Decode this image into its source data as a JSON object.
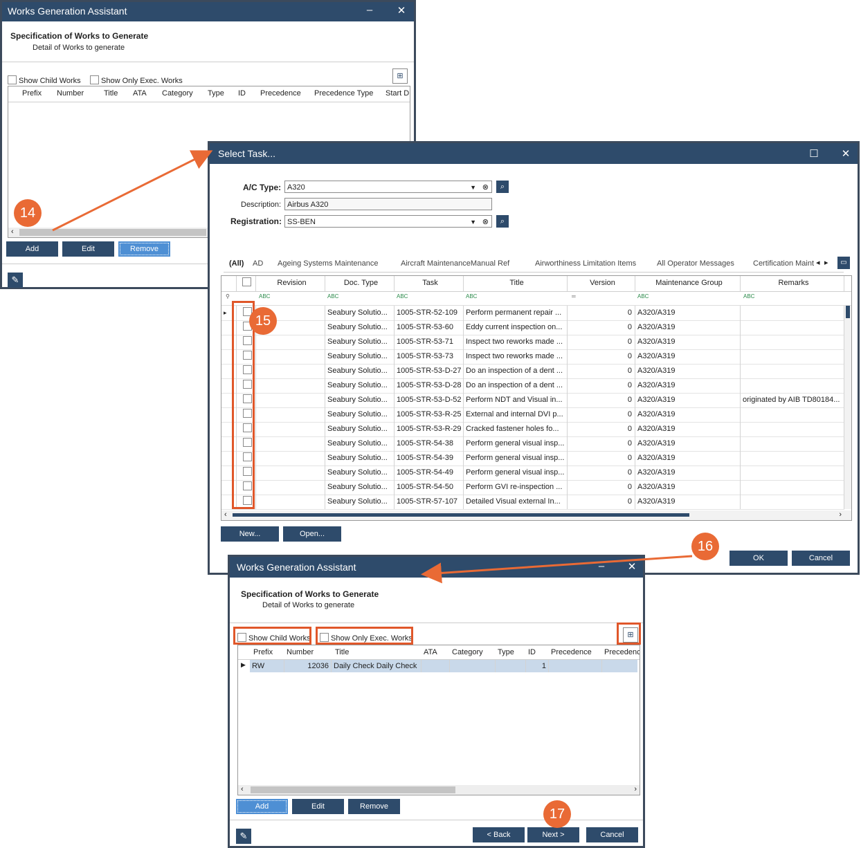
{
  "bg_window": {
    "title": "Works Generation Assistant",
    "heading": "Specification of Works to Generate",
    "subheading": "Detail of Works to generate",
    "show_child_works": "Show Child Works",
    "show_only_exec": "Show Only Exec. Works",
    "columns": [
      "Prefix",
      "Number",
      "Title",
      "ATA",
      "Category",
      "Type",
      "ID",
      "Precedence",
      "Precedence Type",
      "Start D"
    ],
    "add": "Add",
    "edit": "Edit",
    "remove": "Remove"
  },
  "select_task": {
    "title": "Select Task...",
    "ac_type_label": "A/C Type:",
    "ac_type_value": "A320",
    "description_label": "Description:",
    "description_value": "Airbus A320",
    "registration_label": "Registration:",
    "registration_value": "SS-BEN",
    "tabs": [
      "(All)",
      "AD",
      "Ageing Systems Maintenance",
      "Aircraft MaintenanceManual Ref",
      "Airworthiness Limitation Items",
      "All Operator Messages",
      "Certification Maint"
    ],
    "columns": [
      "Revision",
      "Doc. Type",
      "Task",
      "Title",
      "Version",
      "Maintenance Group",
      "Remarks"
    ],
    "rows": [
      {
        "doc": "Seabury Solutio...",
        "task": "1005-STR-52-109",
        "title": "Perform permanent repair ...",
        "version": "0",
        "group": "A320/A319",
        "remarks": ""
      },
      {
        "doc": "Seabury Solutio...",
        "task": "1005-STR-53-60",
        "title": "Eddy current inspection on...",
        "version": "0",
        "group": "A320/A319",
        "remarks": ""
      },
      {
        "doc": "Seabury Solutio...",
        "task": "1005-STR-53-71",
        "title": "Inspect two reworks made ...",
        "version": "0",
        "group": "A320/A319",
        "remarks": ""
      },
      {
        "doc": "Seabury Solutio...",
        "task": "1005-STR-53-73",
        "title": "Inspect two reworks made ...",
        "version": "0",
        "group": "A320/A319",
        "remarks": ""
      },
      {
        "doc": "Seabury Solutio...",
        "task": "1005-STR-53-D-27",
        "title": "Do an inspection of a dent ...",
        "version": "0",
        "group": "A320/A319",
        "remarks": ""
      },
      {
        "doc": "Seabury Solutio...",
        "task": "1005-STR-53-D-28",
        "title": "Do an inspection of a dent ...",
        "version": "0",
        "group": "A320/A319",
        "remarks": ""
      },
      {
        "doc": "Seabury Solutio...",
        "task": "1005-STR-53-D-52",
        "title": "Perform NDT and Visual  in...",
        "version": "0",
        "group": "A320/A319",
        "remarks": "originated by AIB TD80184..."
      },
      {
        "doc": "Seabury Solutio...",
        "task": "1005-STR-53-R-25",
        "title": "External and internal DVI p...",
        "version": "0",
        "group": "A320/A319",
        "remarks": ""
      },
      {
        "doc": "Seabury Solutio...",
        "task": "1005-STR-53-R-29",
        "title": "Cracked fastener holes fo...",
        "version": "0",
        "group": "A320/A319",
        "remarks": ""
      },
      {
        "doc": "Seabury Solutio...",
        "task": "1005-STR-54-38",
        "title": "Perform general visual insp...",
        "version": "0",
        "group": "A320/A319",
        "remarks": ""
      },
      {
        "doc": "Seabury Solutio...",
        "task": "1005-STR-54-39",
        "title": "Perform general visual insp...",
        "version": "0",
        "group": "A320/A319",
        "remarks": ""
      },
      {
        "doc": "Seabury Solutio...",
        "task": "1005-STR-54-49",
        "title": "Perform general visual insp...",
        "version": "0",
        "group": "A320/A319",
        "remarks": ""
      },
      {
        "doc": "Seabury Solutio...",
        "task": "1005-STR-54-50",
        "title": "Perform GVI  re-inspection ...",
        "version": "0",
        "group": "A320/A319",
        "remarks": ""
      },
      {
        "doc": "Seabury Solutio...",
        "task": "1005-STR-57-107",
        "title": "Detailed Visual  external In...",
        "version": "0",
        "group": "A320/A319",
        "remarks": ""
      }
    ],
    "new": "New...",
    "open": "Open...",
    "ok": "OK",
    "cancel": "Cancel"
  },
  "fg_window": {
    "title": "Works Generation Assistant",
    "heading": "Specification of Works to Generate",
    "subheading": "Detail of Works to generate",
    "show_child_works": "Show Child Works",
    "show_only_exec": "Show Only Exec. Works",
    "columns": [
      "Prefix",
      "Number",
      "Title",
      "ATA",
      "Category",
      "Type",
      "ID",
      "Precedence",
      "Precedence"
    ],
    "row": {
      "prefix": "RW",
      "number": "12036",
      "title": "Daily Check Daily Check",
      "id": "1"
    },
    "add": "Add",
    "edit": "Edit",
    "remove": "Remove",
    "back": "< Back",
    "next": "Next >",
    "cancel": "Cancel"
  },
  "callouts": [
    "14",
    "15",
    "16",
    "17"
  ],
  "colors": {
    "titlebar": "#2e4b6b",
    "button": "#2e4b6b",
    "callout": "#e96a35",
    "highlight": "#e0572a",
    "selected_row": "#c9d9ea"
  }
}
